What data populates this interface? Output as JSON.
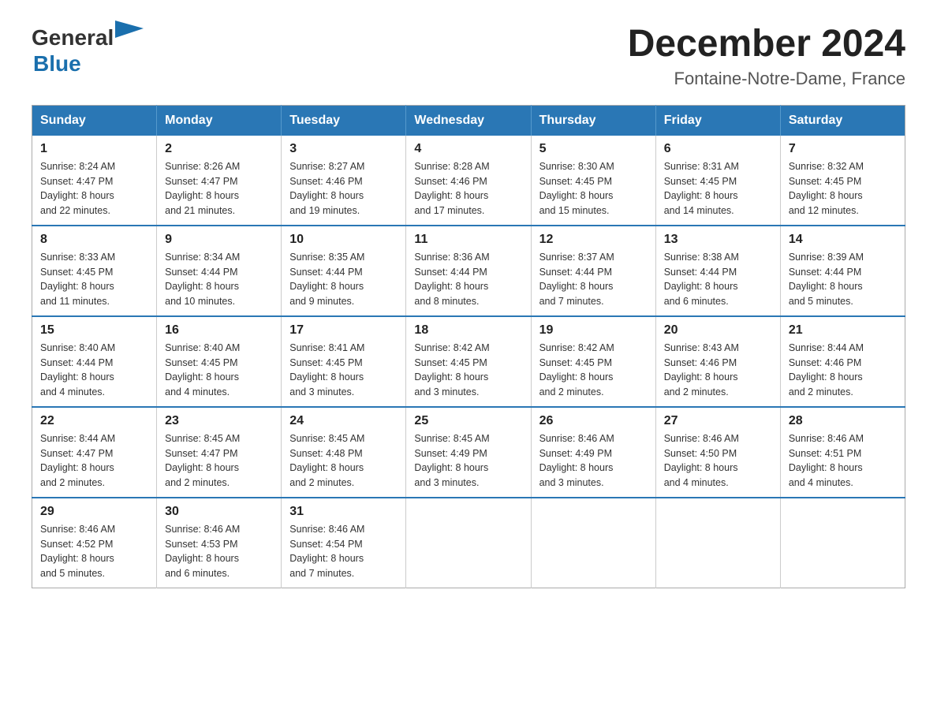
{
  "header": {
    "logo_text_general": "General",
    "logo_text_blue": "Blue",
    "month_title": "December 2024",
    "location": "Fontaine-Notre-Dame, France"
  },
  "weekdays": [
    "Sunday",
    "Monday",
    "Tuesday",
    "Wednesday",
    "Thursday",
    "Friday",
    "Saturday"
  ],
  "weeks": [
    [
      {
        "day": "1",
        "sunrise": "8:24 AM",
        "sunset": "4:47 PM",
        "daylight": "8 hours and 22 minutes."
      },
      {
        "day": "2",
        "sunrise": "8:26 AM",
        "sunset": "4:47 PM",
        "daylight": "8 hours and 21 minutes."
      },
      {
        "day": "3",
        "sunrise": "8:27 AM",
        "sunset": "4:46 PM",
        "daylight": "8 hours and 19 minutes."
      },
      {
        "day": "4",
        "sunrise": "8:28 AM",
        "sunset": "4:46 PM",
        "daylight": "8 hours and 17 minutes."
      },
      {
        "day": "5",
        "sunrise": "8:30 AM",
        "sunset": "4:45 PM",
        "daylight": "8 hours and 15 minutes."
      },
      {
        "day": "6",
        "sunrise": "8:31 AM",
        "sunset": "4:45 PM",
        "daylight": "8 hours and 14 minutes."
      },
      {
        "day": "7",
        "sunrise": "8:32 AM",
        "sunset": "4:45 PM",
        "daylight": "8 hours and 12 minutes."
      }
    ],
    [
      {
        "day": "8",
        "sunrise": "8:33 AM",
        "sunset": "4:45 PM",
        "daylight": "8 hours and 11 minutes."
      },
      {
        "day": "9",
        "sunrise": "8:34 AM",
        "sunset": "4:44 PM",
        "daylight": "8 hours and 10 minutes."
      },
      {
        "day": "10",
        "sunrise": "8:35 AM",
        "sunset": "4:44 PM",
        "daylight": "8 hours and 9 minutes."
      },
      {
        "day": "11",
        "sunrise": "8:36 AM",
        "sunset": "4:44 PM",
        "daylight": "8 hours and 8 minutes."
      },
      {
        "day": "12",
        "sunrise": "8:37 AM",
        "sunset": "4:44 PM",
        "daylight": "8 hours and 7 minutes."
      },
      {
        "day": "13",
        "sunrise": "8:38 AM",
        "sunset": "4:44 PM",
        "daylight": "8 hours and 6 minutes."
      },
      {
        "day": "14",
        "sunrise": "8:39 AM",
        "sunset": "4:44 PM",
        "daylight": "8 hours and 5 minutes."
      }
    ],
    [
      {
        "day": "15",
        "sunrise": "8:40 AM",
        "sunset": "4:44 PM",
        "daylight": "8 hours and 4 minutes."
      },
      {
        "day": "16",
        "sunrise": "8:40 AM",
        "sunset": "4:45 PM",
        "daylight": "8 hours and 4 minutes."
      },
      {
        "day": "17",
        "sunrise": "8:41 AM",
        "sunset": "4:45 PM",
        "daylight": "8 hours and 3 minutes."
      },
      {
        "day": "18",
        "sunrise": "8:42 AM",
        "sunset": "4:45 PM",
        "daylight": "8 hours and 3 minutes."
      },
      {
        "day": "19",
        "sunrise": "8:42 AM",
        "sunset": "4:45 PM",
        "daylight": "8 hours and 2 minutes."
      },
      {
        "day": "20",
        "sunrise": "8:43 AM",
        "sunset": "4:46 PM",
        "daylight": "8 hours and 2 minutes."
      },
      {
        "day": "21",
        "sunrise": "8:44 AM",
        "sunset": "4:46 PM",
        "daylight": "8 hours and 2 minutes."
      }
    ],
    [
      {
        "day": "22",
        "sunrise": "8:44 AM",
        "sunset": "4:47 PM",
        "daylight": "8 hours and 2 minutes."
      },
      {
        "day": "23",
        "sunrise": "8:45 AM",
        "sunset": "4:47 PM",
        "daylight": "8 hours and 2 minutes."
      },
      {
        "day": "24",
        "sunrise": "8:45 AM",
        "sunset": "4:48 PM",
        "daylight": "8 hours and 2 minutes."
      },
      {
        "day": "25",
        "sunrise": "8:45 AM",
        "sunset": "4:49 PM",
        "daylight": "8 hours and 3 minutes."
      },
      {
        "day": "26",
        "sunrise": "8:46 AM",
        "sunset": "4:49 PM",
        "daylight": "8 hours and 3 minutes."
      },
      {
        "day": "27",
        "sunrise": "8:46 AM",
        "sunset": "4:50 PM",
        "daylight": "8 hours and 4 minutes."
      },
      {
        "day": "28",
        "sunrise": "8:46 AM",
        "sunset": "4:51 PM",
        "daylight": "8 hours and 4 minutes."
      }
    ],
    [
      {
        "day": "29",
        "sunrise": "8:46 AM",
        "sunset": "4:52 PM",
        "daylight": "8 hours and 5 minutes."
      },
      {
        "day": "30",
        "sunrise": "8:46 AM",
        "sunset": "4:53 PM",
        "daylight": "8 hours and 6 minutes."
      },
      {
        "day": "31",
        "sunrise": "8:46 AM",
        "sunset": "4:54 PM",
        "daylight": "8 hours and 7 minutes."
      },
      null,
      null,
      null,
      null
    ]
  ],
  "labels": {
    "sunrise": "Sunrise:",
    "sunset": "Sunset:",
    "daylight": "Daylight:"
  }
}
